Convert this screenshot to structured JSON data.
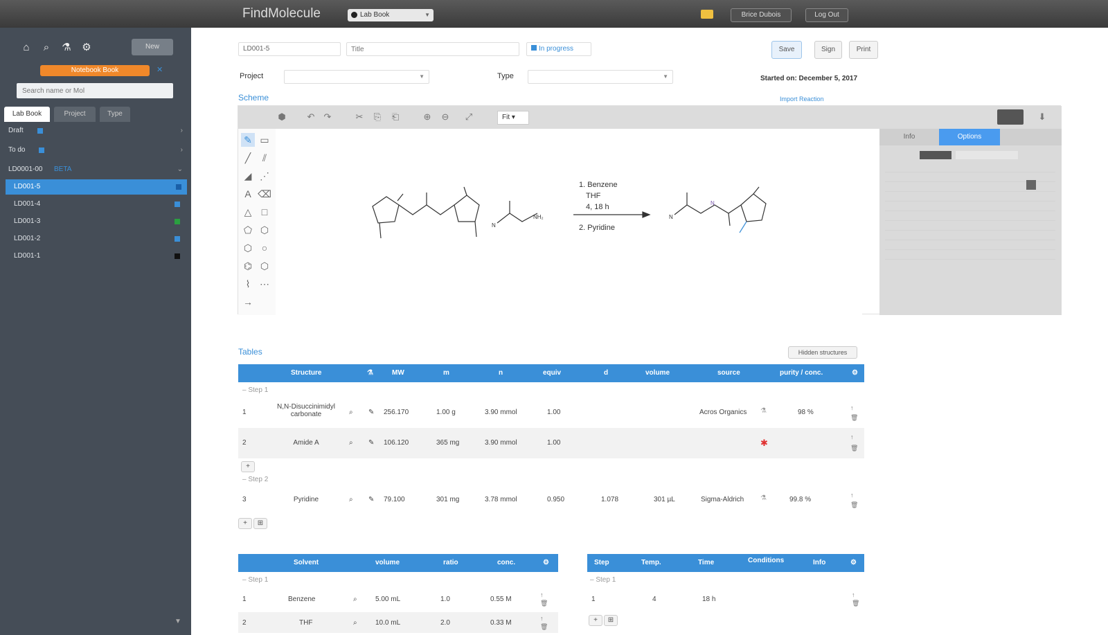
{
  "app": {
    "name": "FindMolecule",
    "notebook": "Lab Book"
  },
  "topbar": {
    "btn_account": "Brice Dubois",
    "btn_logout": "Log Out"
  },
  "sidebar": {
    "new_label": "New",
    "filter_label": "Notebook Book",
    "search_placeholder": "Search name or Mol",
    "tabs": [
      "Lab Book",
      "Project",
      "Type"
    ],
    "rows": [
      {
        "label": "Draft",
        "color": "#3a8fd8"
      },
      {
        "label": "To do",
        "color": "#3a8fd8"
      },
      {
        "label": "LD0001-00",
        "badge": "BETA",
        "color": "#3a8fd8"
      }
    ],
    "subs": [
      {
        "label": "LD001-5",
        "color": "#3a8fd8"
      },
      {
        "label": "LD001-4",
        "color": "#3a8fd8"
      },
      {
        "label": "LD001-3",
        "color": "#2aa040"
      },
      {
        "label": "LD001-2",
        "color": "#3a8fd8"
      },
      {
        "label": "LD001-1",
        "color": "#111111"
      }
    ]
  },
  "header": {
    "id_value": "LD001-5",
    "title_placeholder": "Title",
    "status_label": "In progress",
    "btn_save": "Save",
    "btn_sign": "Sign",
    "btn_print": "Print",
    "project_label": "Project",
    "type_label": "Type",
    "started": "Started on: December 5, 2017"
  },
  "scheme": {
    "title": "Scheme",
    "import_link": "Import Reaction",
    "zoom_select": "Fit",
    "panel_tabs": [
      "Info",
      "Options"
    ],
    "conditions": [
      "1. Benzene",
      "THF",
      "4, 18 h",
      "2. Pyridine"
    ]
  },
  "tables": {
    "title": "Tables",
    "toggle_label": "Hidden structures",
    "reagents_headers": [
      "Structure",
      "MW",
      "m",
      "n",
      "equiv",
      "d",
      "volume",
      "source",
      "purity / conc."
    ],
    "groups": [
      "Step 1",
      "Step 2"
    ],
    "reagents": [
      {
        "index": "1",
        "name": "N,N-Disuccinimidyl carbonate",
        "mw": "256.170",
        "m": "1.00 g",
        "n": "3.90 mmol",
        "eq": "1.00",
        "d": "",
        "vol": "",
        "source": "Acros Organics",
        "purity": "98 %"
      },
      {
        "index": "2",
        "name": "Amide A",
        "mw": "106.120",
        "m": "365 mg",
        "n": "3.90 mmol",
        "eq": "1.00",
        "d": "",
        "vol": "",
        "source": "",
        "purity": ""
      },
      {
        "index": "3",
        "name": "Pyridine",
        "mw": "79.100",
        "m": "301 mg",
        "n": "3.78 mmol",
        "eq": "0.950",
        "d": "1.078",
        "vol": "301 µL",
        "source": "Sigma-Aldrich",
        "purity": "99.8 %"
      }
    ],
    "solvent_headers": [
      "Solvent",
      "volume",
      "ratio",
      "conc."
    ],
    "solvents": [
      {
        "index": "1",
        "name": "Benzene",
        "vol": "5.00 mL",
        "ratio": "1.0",
        "conc": "0.55 M"
      },
      {
        "index": "2",
        "name": "THF",
        "vol": "10.0 mL",
        "ratio": "2.0",
        "conc": "0.33 M"
      }
    ],
    "cond_headers": [
      "Step",
      "Temp.",
      "Time",
      "Conditions",
      "Info"
    ],
    "conds": [
      {
        "index": "1",
        "temp": "4",
        "time": "18 h"
      }
    ]
  }
}
